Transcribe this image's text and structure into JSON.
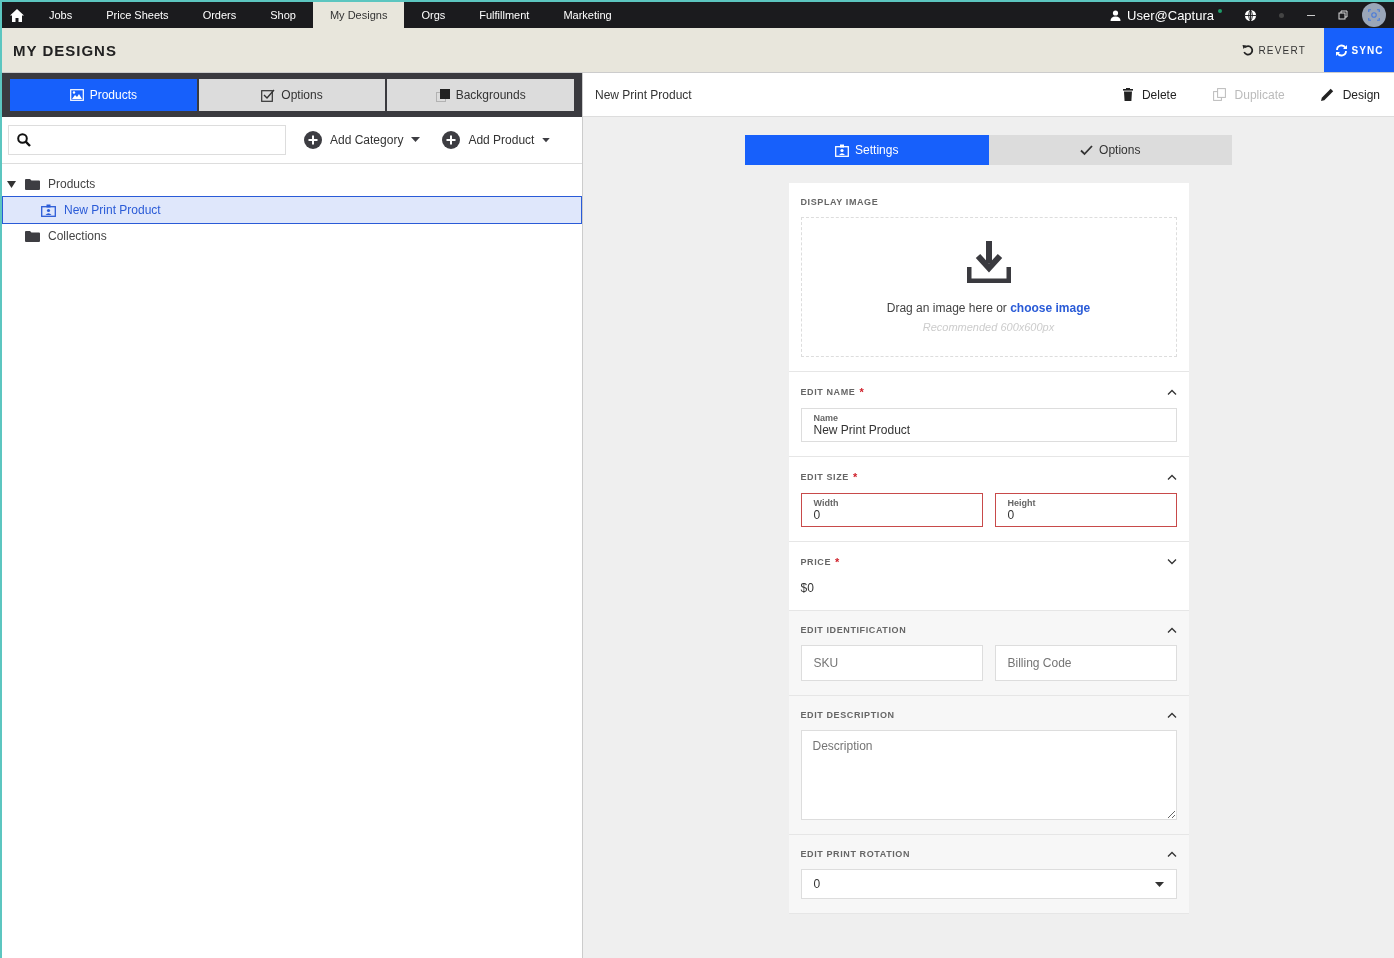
{
  "nav": {
    "items": [
      {
        "label": "Jobs",
        "selected": false
      },
      {
        "label": "Price Sheets",
        "selected": false
      },
      {
        "label": "Orders",
        "selected": false
      },
      {
        "label": "Shop",
        "selected": false
      },
      {
        "label": "My Designs",
        "selected": true
      },
      {
        "label": "Orgs",
        "selected": false
      },
      {
        "label": "Fulfillment",
        "selected": false
      },
      {
        "label": "Marketing",
        "selected": false
      }
    ],
    "user": "User@Captura",
    "online": true
  },
  "header": {
    "title": "MY DESIGNS",
    "revert": "REVERT",
    "sync": "SYNC"
  },
  "left_tabs": [
    {
      "label": "Products",
      "kind": "picture",
      "selected": true
    },
    {
      "label": "Options",
      "kind": "check",
      "selected": false
    },
    {
      "label": "Backgrounds",
      "kind": "layers",
      "selected": false
    }
  ],
  "add_category": "Add Category",
  "add_product": "Add Product",
  "tree": [
    {
      "label": "Products",
      "kind": "folder",
      "expanded": true,
      "selected": false,
      "children": [
        {
          "label": "New Print Product",
          "kind": "product",
          "selected": true
        }
      ]
    },
    {
      "label": "Collections",
      "kind": "folder",
      "expanded": false,
      "selected": false
    }
  ],
  "editor": {
    "title": "New Print Product",
    "actions": [
      {
        "label": "Delete",
        "kind": "trash",
        "disabled": false
      },
      {
        "label": "Duplicate",
        "kind": "copy",
        "disabled": true
      },
      {
        "label": "Design",
        "kind": "pencil",
        "disabled": false
      }
    ],
    "tabs": [
      {
        "label": "Settings",
        "kind": "settings",
        "selected": true
      },
      {
        "label": "Options",
        "kind": "check",
        "selected": false
      }
    ],
    "sections": [
      {
        "kind": "image",
        "title": "DISPLAY IMAGE",
        "prompt": "Drag an image here or",
        "link": "choose image",
        "hint": "Recommended 600x600px"
      },
      {
        "kind": "fields",
        "title": "EDIT NAME",
        "required_mark": "*",
        "expanded": true,
        "fields": [
          {
            "label": "Name",
            "value": "New Print Product",
            "invalid": false
          }
        ]
      },
      {
        "kind": "fields",
        "title": "EDIT SIZE",
        "required_mark": "*",
        "expanded": true,
        "fields": [
          {
            "label": "Width",
            "value": "0",
            "invalid": true
          },
          {
            "label": "Height",
            "value": "0",
            "invalid": true
          }
        ]
      },
      {
        "kind": "value",
        "title": "PRICE",
        "required_mark": "*",
        "expanded": false,
        "value": "$0"
      },
      {
        "kind": "fields",
        "title": "EDIT IDENTIFICATION",
        "expanded": true,
        "fields": [
          {
            "placeholder": "SKU",
            "invalid": false
          },
          {
            "placeholder": "Billing Code",
            "invalid": false
          }
        ]
      },
      {
        "kind": "textarea",
        "title": "EDIT DESCRIPTION",
        "expanded": true,
        "placeholder": "Description"
      },
      {
        "kind": "select",
        "title": "EDIT PRINT ROTATION",
        "expanded": true,
        "value": "0"
      }
    ]
  }
}
